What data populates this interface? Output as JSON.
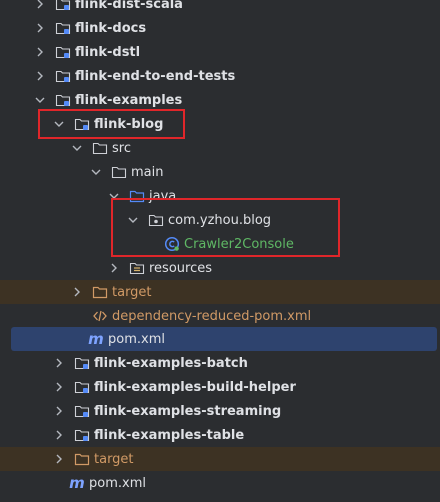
{
  "tree": {
    "items": [
      {
        "label": "flink-dist-scala",
        "icon": "module-folder-icon",
        "chevron": "right",
        "bold": true
      },
      {
        "label": "flink-docs",
        "icon": "module-folder-icon",
        "chevron": "right",
        "bold": true
      },
      {
        "label": "flink-dstl",
        "icon": "module-folder-icon",
        "chevron": "right",
        "bold": true
      },
      {
        "label": "flink-end-to-end-tests",
        "icon": "module-folder-icon",
        "chevron": "right",
        "bold": true
      },
      {
        "label": "flink-examples",
        "icon": "module-folder-icon",
        "chevron": "down",
        "bold": true
      },
      {
        "label": "flink-blog",
        "icon": "module-folder-icon",
        "chevron": "down",
        "bold": true
      },
      {
        "label": "src",
        "icon": "folder-icon",
        "chevron": "down"
      },
      {
        "label": "main",
        "icon": "folder-icon",
        "chevron": "down"
      },
      {
        "label": "java",
        "icon": "source-root-folder-icon",
        "chevron": "down"
      },
      {
        "label": "com.yzhou.blog",
        "icon": "package-icon",
        "chevron": "down"
      },
      {
        "label": "Crawler2Console",
        "icon": "java-class-icon",
        "chevron": "none"
      },
      {
        "label": "resources",
        "icon": "resources-folder-icon",
        "chevron": "right"
      },
      {
        "label": "target",
        "icon": "excluded-folder-icon",
        "chevron": "right"
      },
      {
        "label": "dependency-reduced-pom.xml",
        "icon": "xml-file-icon",
        "chevron": "none"
      },
      {
        "label": "pom.xml",
        "icon": "maven-icon",
        "chevron": "none"
      },
      {
        "label": "flink-examples-batch",
        "icon": "module-folder-icon",
        "chevron": "right",
        "bold": true
      },
      {
        "label": "flink-examples-build-helper",
        "icon": "module-folder-icon",
        "chevron": "right",
        "bold": true
      },
      {
        "label": "flink-examples-streaming",
        "icon": "module-folder-icon",
        "chevron": "right",
        "bold": true
      },
      {
        "label": "flink-examples-table",
        "icon": "module-folder-icon",
        "chevron": "right",
        "bold": true
      },
      {
        "label": "target",
        "icon": "excluded-folder-icon",
        "chevron": "right"
      },
      {
        "label": "pom.xml",
        "icon": "maven-icon",
        "chevron": "none"
      }
    ]
  },
  "colors": {
    "background": "#2b2d30",
    "text": "#dfe1e5",
    "excluded_text": "#d19a66",
    "class_text": "#5fb865",
    "selection": "#2e436e",
    "excluded_row": "#3d3223",
    "highlight_box": "#e0262a"
  }
}
